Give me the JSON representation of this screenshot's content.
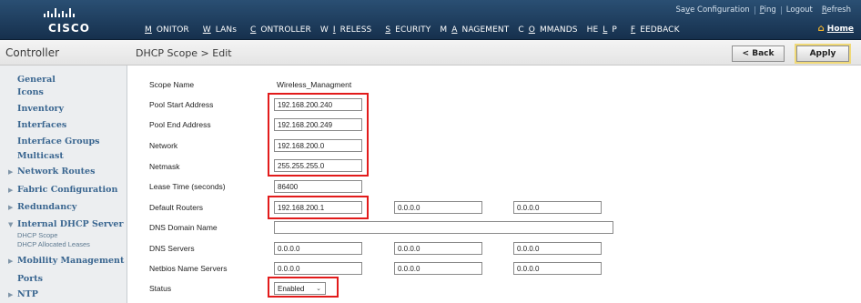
{
  "brand": {
    "wordmark": "CISCO"
  },
  "utility": {
    "save_config": "Save Configuration",
    "ping": "Ping",
    "logout": "Logout",
    "refresh": "Refresh",
    "home": "Home"
  },
  "menu": [
    "MONITOR",
    "WLANs",
    "CONTROLLER",
    "WIRELESS",
    "SECURITY",
    "MANAGEMENT",
    "COMMANDS",
    "HELP",
    "FEEDBACK"
  ],
  "header": {
    "section": "Controller",
    "page_title": "DHCP Scope > Edit",
    "back_label": "< Back",
    "apply_label": "Apply"
  },
  "sidebar": {
    "items": [
      {
        "label": "General",
        "expand": ""
      },
      {
        "label": "Icons",
        "expand": ""
      },
      {
        "label": "Inventory",
        "expand": ""
      },
      {
        "label": "Interfaces",
        "expand": ""
      },
      {
        "label": "Interface Groups",
        "expand": ""
      },
      {
        "label": "Multicast",
        "expand": ""
      },
      {
        "label": "Network Routes",
        "expand": "collapsed"
      },
      {
        "label": "Fabric Configuration",
        "expand": "collapsed"
      },
      {
        "label": "Redundancy",
        "expand": "collapsed"
      },
      {
        "label": "Internal DHCP Server",
        "expand": "expanded"
      },
      {
        "label": "Mobility Management",
        "expand": "collapsed"
      },
      {
        "label": "Ports",
        "expand": ""
      },
      {
        "label": "NTP",
        "expand": "collapsed"
      }
    ],
    "subitems": [
      "DHCP Scope",
      "DHCP Allocated Leases"
    ]
  },
  "form": {
    "scope_name_label": "Scope Name",
    "scope_name_value": "Wireless_Managment",
    "pool_start_label": "Pool Start Address",
    "pool_start_value": "192.168.200.240",
    "pool_end_label": "Pool End Address",
    "pool_end_value": "192.168.200.249",
    "network_label": "Network",
    "network_value": "192.168.200.0",
    "netmask_label": "Netmask",
    "netmask_value": "255.255.255.0",
    "lease_time_label": "Lease Time (seconds)",
    "lease_time_value": "86400",
    "default_routers_label": "Default Routers",
    "default_routers": [
      "192.168.200.1",
      "0.0.0.0",
      "0.0.0.0"
    ],
    "dns_domain_label": "DNS Domain Name",
    "dns_domain_value": "",
    "dns_servers_label": "DNS Servers",
    "dns_servers": [
      "0.0.0.0",
      "0.0.0.0",
      "0.0.0.0"
    ],
    "netbios_label": "Netbios Name Servers",
    "netbios_servers": [
      "0.0.0.0",
      "0.0.0.0",
      "0.0.0.0"
    ],
    "status_label": "Status",
    "status_value": "Enabled"
  },
  "colors": {
    "highlight": "#e21b1b",
    "header_bg": "#1f3f60",
    "nav_link": "#3a6690",
    "apply_glow": "#f0d977"
  }
}
